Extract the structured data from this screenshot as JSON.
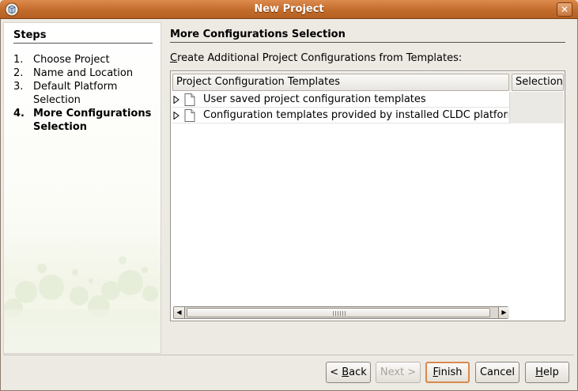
{
  "window": {
    "title": "New Project"
  },
  "steps": {
    "heading": "Steps",
    "items": [
      {
        "num": "1.",
        "label": "Choose Project"
      },
      {
        "num": "2.",
        "label": "Name and Location"
      },
      {
        "num": "3.",
        "label": "Default Platform Selection"
      },
      {
        "num": "4.",
        "label": "More Configurations Selection"
      }
    ],
    "current_index": 3
  },
  "main": {
    "title": "More Configurations Selection",
    "subtitle_mnemonic": "C",
    "subtitle_rest": "reate Additional Project Configurations from Templates:",
    "table": {
      "columns": [
        "Project Configuration Templates",
        "Selection"
      ],
      "rows": [
        {
          "label": "User saved project configuration templates"
        },
        {
          "label": "Configuration templates provided by installed CLDC platforms"
        }
      ]
    }
  },
  "buttons": {
    "back": {
      "pre": "< ",
      "mnemonic": "B",
      "rest": "ack"
    },
    "next": {
      "label": "Next >"
    },
    "finish": {
      "mnemonic": "F",
      "rest": "inish"
    },
    "cancel": {
      "label": "Cancel"
    },
    "help": {
      "mnemonic": "H",
      "rest": "elp"
    }
  },
  "icons": {
    "app": "netbeans-cube-icon",
    "close": "close-icon",
    "expander": "triangle-right-icon",
    "doc": "document-icon"
  },
  "colors": {
    "titlebar": "#c26c2c",
    "default_button_border": "#d88a4e"
  }
}
